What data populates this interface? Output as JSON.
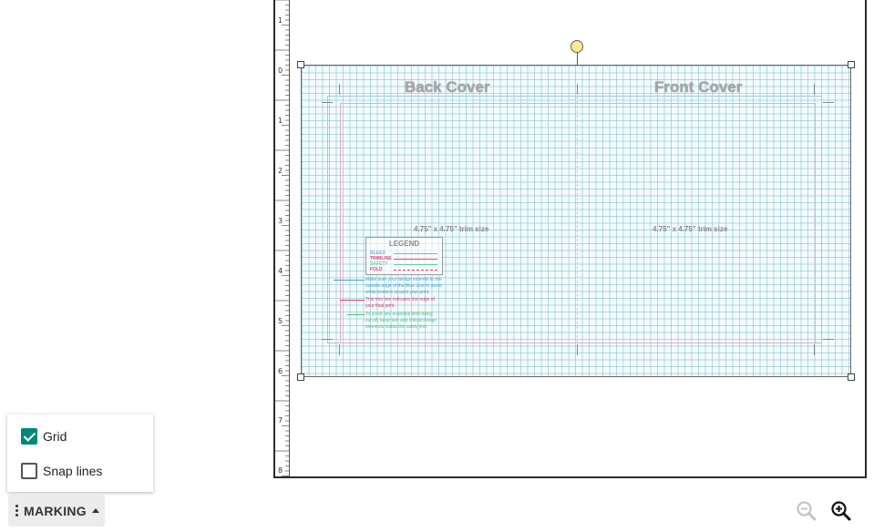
{
  "editor": {
    "ruler_labels": [
      "1",
      "0",
      "1",
      "2",
      "3",
      "4",
      "5",
      "6",
      "7",
      "8"
    ],
    "back_cover_title": "Back Cover",
    "front_cover_title": "Front Cover",
    "back_trim_size": "4.75\" x 4.75\" trim size",
    "front_trim_size": "4.75\" x 4.75\" trim size",
    "legend": {
      "title": "LEGEND",
      "items": [
        {
          "label": "BLEED",
          "color": "#6fb3dd"
        },
        {
          "label": "TRIMLINE",
          "color": "#e6407a"
        },
        {
          "label": "SAFETY",
          "color": "#6ccf9a"
        },
        {
          "label": "FOLD",
          "color": "#e6407a"
        }
      ]
    },
    "notes": [
      {
        "line1": "Make sure your design extends to the",
        "line2": "outside edge of the Blue Line to avoid",
        "line3": "white borders around your print.",
        "color": "#4a9fd6"
      },
      {
        "line1": "This trim line indicates the edge of",
        "line2": "your final print.",
        "line3": "",
        "color": "#e6407a"
      },
      {
        "line1": "To avoid any essential item being",
        "line2": "cut off, keep text and critical design",
        "line3": "elements inside the safety line.",
        "color": "#4fbf7e"
      }
    ],
    "colors": {
      "bleed": "#9ccbe0",
      "trim": "#f0a9c4",
      "grid": "#78bec8",
      "accent": "#00897b"
    }
  },
  "options": {
    "grid_label": "Grid",
    "grid_checked": true,
    "snap_label": "Snap lines",
    "snap_checked": false
  },
  "toolbar": {
    "marking_label": "MARKING",
    "zoom_out_icon": "zoom-out-icon",
    "zoom_in_icon": "zoom-in-icon"
  }
}
